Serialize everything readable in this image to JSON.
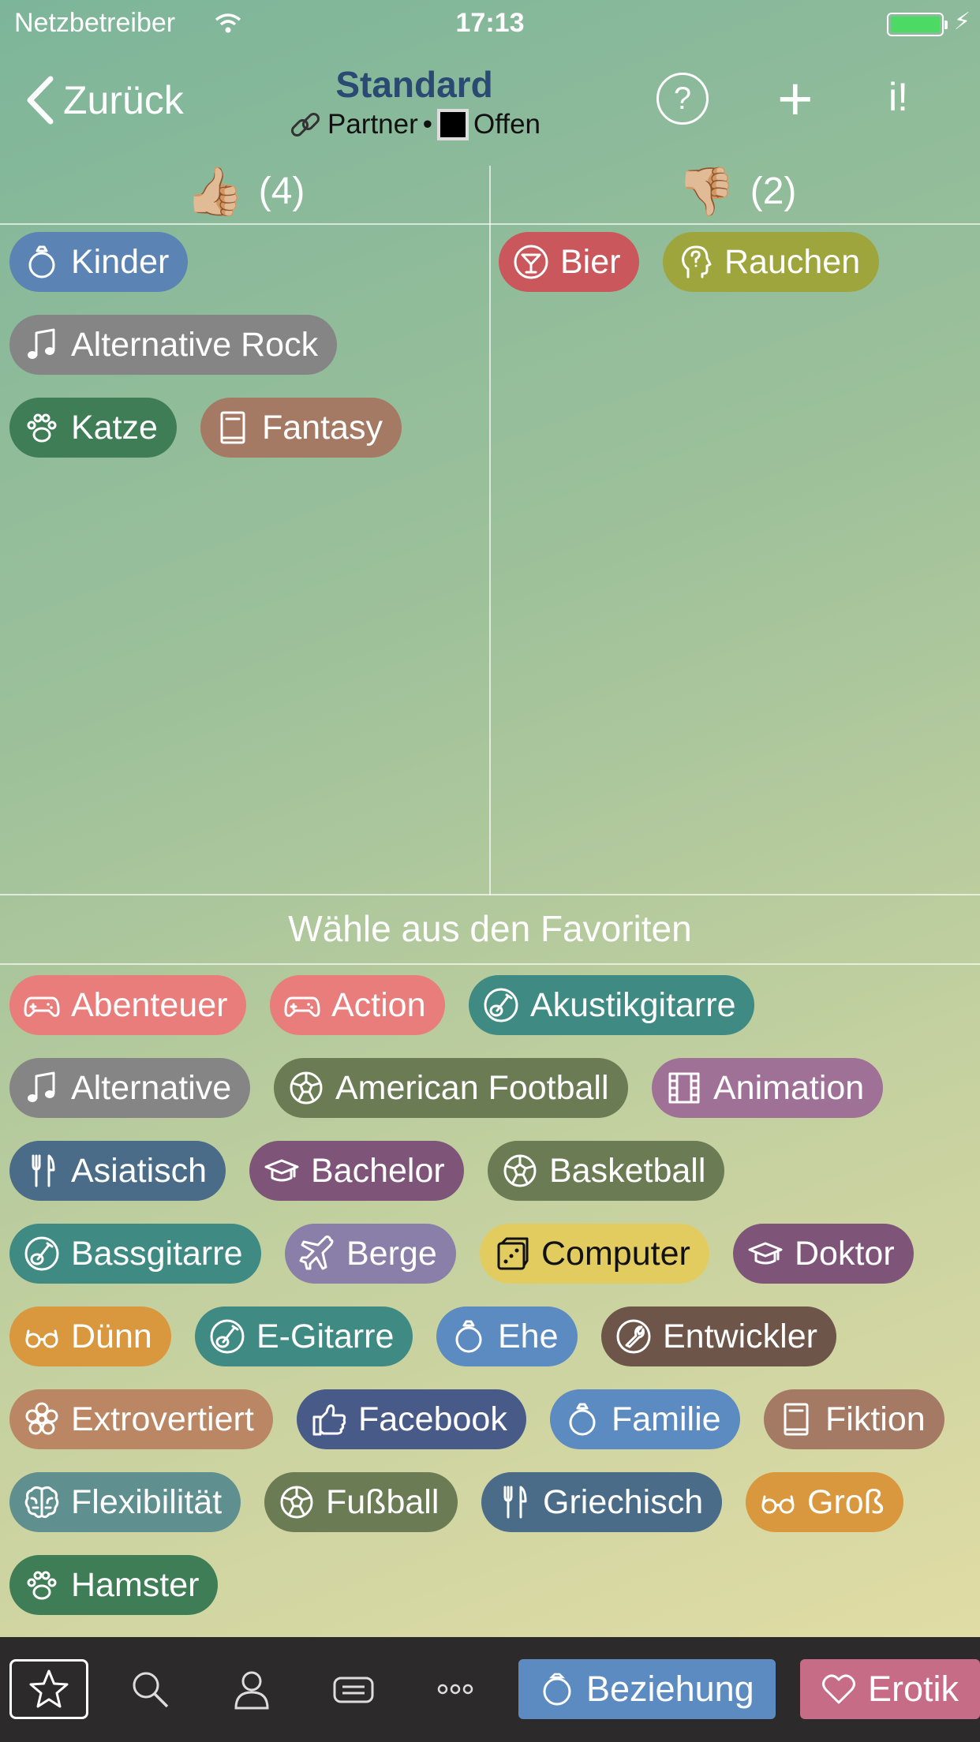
{
  "status": {
    "carrier": "Netzbetreiber",
    "time": "17:13"
  },
  "nav": {
    "back": "Zurück",
    "title": "Standard",
    "subtitle_partner": "Partner",
    "subtitle_sep": "•",
    "subtitle_state": "Offen",
    "help": "?",
    "add": "+",
    "info": "i!"
  },
  "columns": {
    "likes_count": "(4)",
    "dislikes_count": "(2)"
  },
  "likes": [
    {
      "label": "Kinder",
      "icon": "ring-icon",
      "color": "#5b83b3"
    },
    {
      "label": "Alternative Rock",
      "icon": "music-note-icon",
      "color": "#858585"
    },
    {
      "label": "Katze",
      "icon": "paw-icon",
      "color": "#3e7d56"
    },
    {
      "label": "Fantasy",
      "icon": "book-icon",
      "color": "#a57a64"
    }
  ],
  "dislikes": [
    {
      "label": "Bier",
      "icon": "cocktail-icon",
      "color": "#c9575c"
    },
    {
      "label": "Rauchen",
      "icon": "head-question-icon",
      "color": "#9ea53c"
    }
  ],
  "favorites_title": "Wähle aus den Favoriten",
  "favorites": [
    {
      "label": "Abenteuer",
      "icon": "gamepad-icon",
      "color": "#e87d7b"
    },
    {
      "label": "Action",
      "icon": "gamepad-icon",
      "color": "#e87d7b"
    },
    {
      "label": "Akustikgitarre",
      "icon": "guitar-icon",
      "color": "#3f8a82"
    },
    {
      "label": "Alternative",
      "icon": "music-note-icon",
      "color": "#858585"
    },
    {
      "label": "American Football",
      "icon": "ball-icon",
      "color": "#6b7c55"
    },
    {
      "label": "Animation",
      "icon": "film-icon",
      "color": "#a07196"
    },
    {
      "label": "Asiatisch",
      "icon": "cutlery-icon",
      "color": "#4a6c88"
    },
    {
      "label": "Bachelor",
      "icon": "graduation-cap-icon",
      "color": "#7f5479"
    },
    {
      "label": "Basketball",
      "icon": "ball-icon",
      "color": "#6b7c55"
    },
    {
      "label": "Bassgitarre",
      "icon": "guitar-icon",
      "color": "#3f8a82"
    },
    {
      "label": "Berge",
      "icon": "plane-icon",
      "color": "#8a7fa8"
    },
    {
      "label": "Computer",
      "icon": "dice-icon",
      "color": "#e2cc60"
    },
    {
      "label": "Doktor",
      "icon": "graduation-cap-icon",
      "color": "#7f5479"
    },
    {
      "label": "Dünn",
      "icon": "glasses-icon",
      "color": "#d9973e"
    },
    {
      "label": "E-Gitarre",
      "icon": "guitar-icon",
      "color": "#3f8a82"
    },
    {
      "label": "Ehe",
      "icon": "ring-icon",
      "color": "#5b8bc0"
    },
    {
      "label": "Entwickler",
      "icon": "wrench-icon",
      "color": "#6d5549"
    },
    {
      "label": "Extrovertiert",
      "icon": "flower-icon",
      "color": "#bb8664"
    },
    {
      "label": "Facebook",
      "icon": "thumbs-up-icon",
      "color": "#485b88"
    },
    {
      "label": "Familie",
      "icon": "ring-icon",
      "color": "#5b8bc0"
    },
    {
      "label": "Fiktion",
      "icon": "book-icon",
      "color": "#a57a64"
    },
    {
      "label": "Flexibilität",
      "icon": "brain-icon",
      "color": "#5f8f8f"
    },
    {
      "label": "Fußball",
      "icon": "ball-icon",
      "color": "#6b7c55"
    },
    {
      "label": "Griechisch",
      "icon": "cutlery-icon",
      "color": "#4a6c88"
    },
    {
      "label": "Groß",
      "icon": "glasses-icon",
      "color": "#d9973e"
    },
    {
      "label": "Hamster",
      "icon": "paw-icon",
      "color": "#3e7d56"
    }
  ],
  "tabbar": {
    "relationship": "Beziehung",
    "relationship_color": "#5b8bc0",
    "erotic": "Erotik",
    "erotic_color": "#c66c87"
  }
}
